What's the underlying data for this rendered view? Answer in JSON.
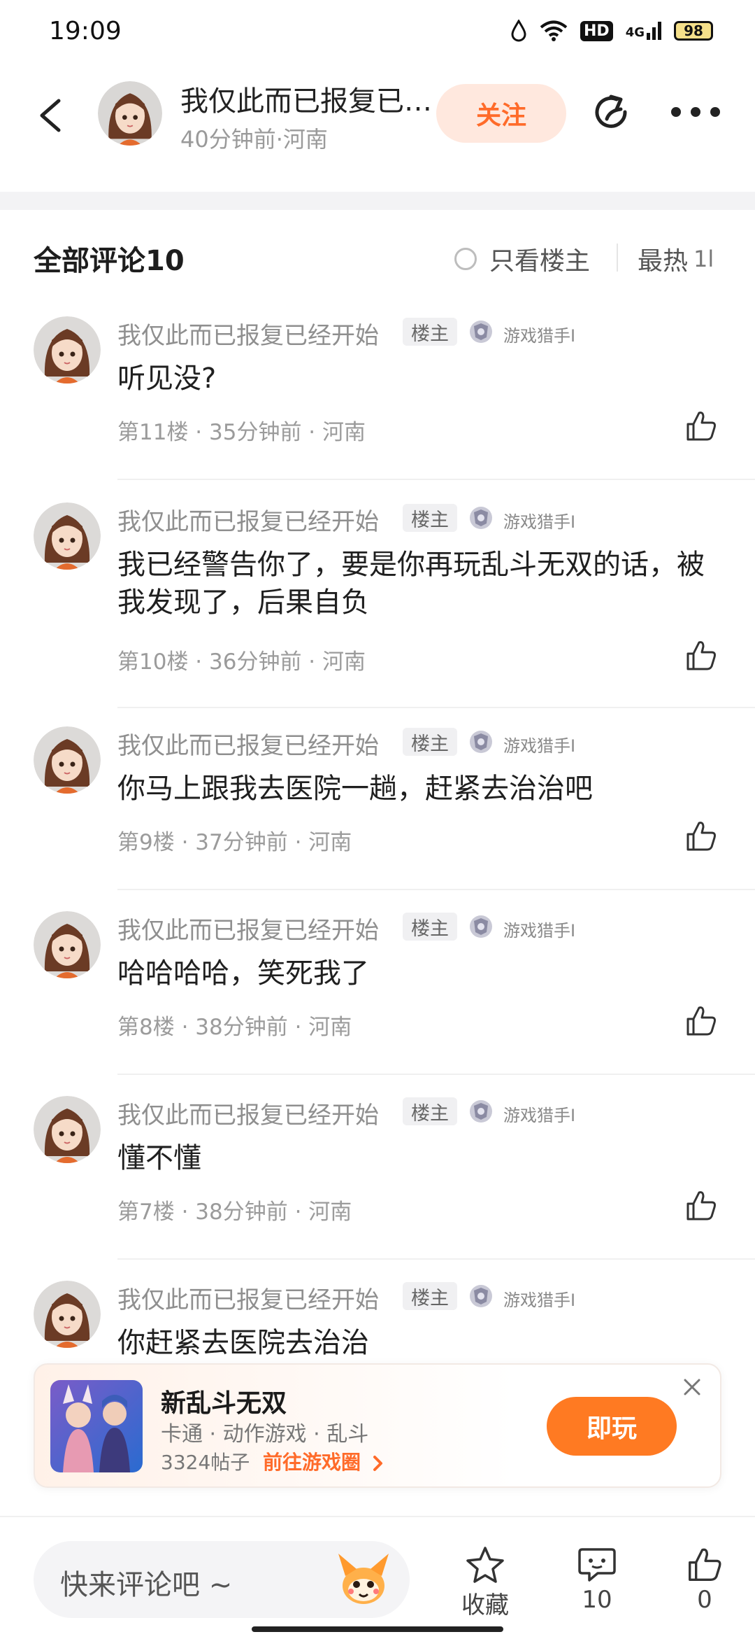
{
  "status_bar": {
    "time": "19:09",
    "hd": "HD",
    "signal": "4G",
    "battery": "98"
  },
  "header": {
    "author_name": "我仅此而已报复已经开始",
    "author_meta": "40分钟前·河南",
    "follow_label": "关注"
  },
  "comments_header": {
    "title": "全部评论10",
    "only_op_label": "只看楼主",
    "sort_label": "最热",
    "sort_icon": "1l"
  },
  "comments": [
    {
      "name": "我仅此而已报复已经开始",
      "op_tag": "楼主",
      "badge": "游戏猎手I",
      "text": "听见没?",
      "meta": "第11楼 · 35分钟前 · 河南"
    },
    {
      "name": "我仅此而已报复已经开始",
      "op_tag": "楼主",
      "badge": "游戏猎手I",
      "text": "我已经警告你了，要是你再玩乱斗无双的话，被我发现了，后果自负",
      "meta": "第10楼 · 36分钟前 · 河南"
    },
    {
      "name": "我仅此而已报复已经开始",
      "op_tag": "楼主",
      "badge": "游戏猎手I",
      "text": "你马上跟我去医院一趟，赶紧去治治吧",
      "meta": "第9楼 · 37分钟前 · 河南"
    },
    {
      "name": "我仅此而已报复已经开始",
      "op_tag": "楼主",
      "badge": "游戏猎手I",
      "text": "哈哈哈哈，笑死我了",
      "meta": "第8楼 · 38分钟前 · 河南"
    },
    {
      "name": "我仅此而已报复已经开始",
      "op_tag": "楼主",
      "badge": "游戏猎手I",
      "text": "懂不懂",
      "meta": "第7楼 · 38分钟前 · 河南"
    },
    {
      "name": "我仅此而已报复已经开始",
      "op_tag": "楼主",
      "badge": "游戏猎手I",
      "text": "你赶紧去医院去治治",
      "meta": ""
    }
  ],
  "game_card": {
    "name": "新乱斗无双",
    "tags": "卡通 · 动作游戏 · 乱斗",
    "posts": "3324帖子",
    "link": "前往游戏圈",
    "play_label": "即玩"
  },
  "bottom_bar": {
    "input_placeholder": "快来评论吧 ~",
    "favorite_label": "收藏",
    "comment_count": "10",
    "like_count": "0"
  },
  "colors": {
    "accent": "#ff7a22",
    "follow_bg": "#ffe8de",
    "muted": "#9b9b9b"
  }
}
